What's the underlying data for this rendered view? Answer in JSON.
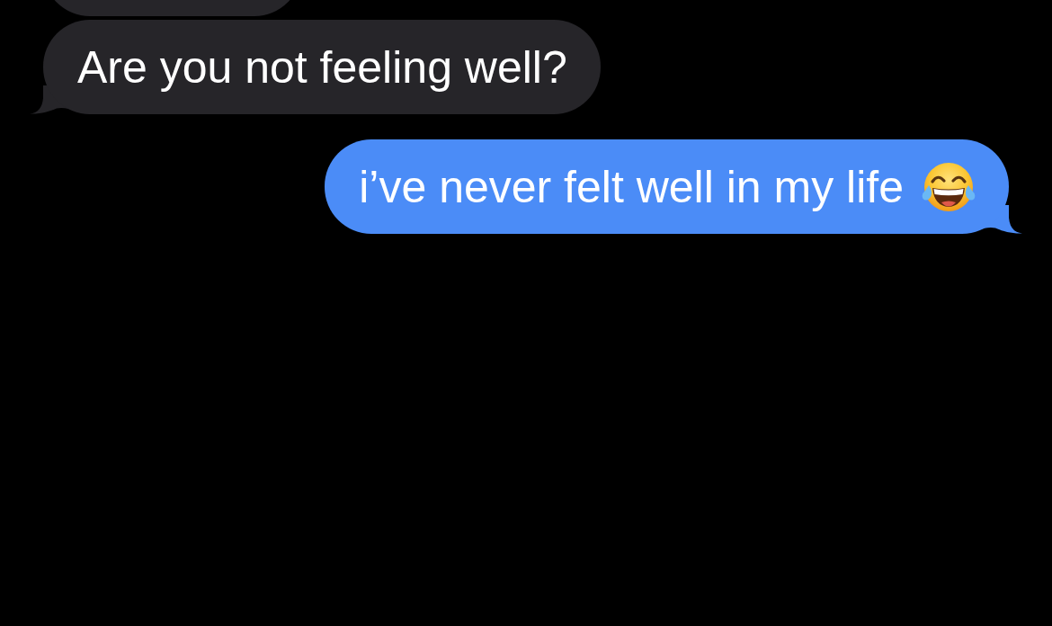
{
  "messages": [
    {
      "kind": "received",
      "cut_off": true,
      "tail": false,
      "emoji": false
    },
    {
      "kind": "received",
      "text": "Are you not feeling well?",
      "cut_off": false,
      "tail": true,
      "emoji": false
    },
    {
      "kind": "sent",
      "text": "i’ve never felt well in my life",
      "cut_off": false,
      "tail": true,
      "emoji": true
    }
  ]
}
